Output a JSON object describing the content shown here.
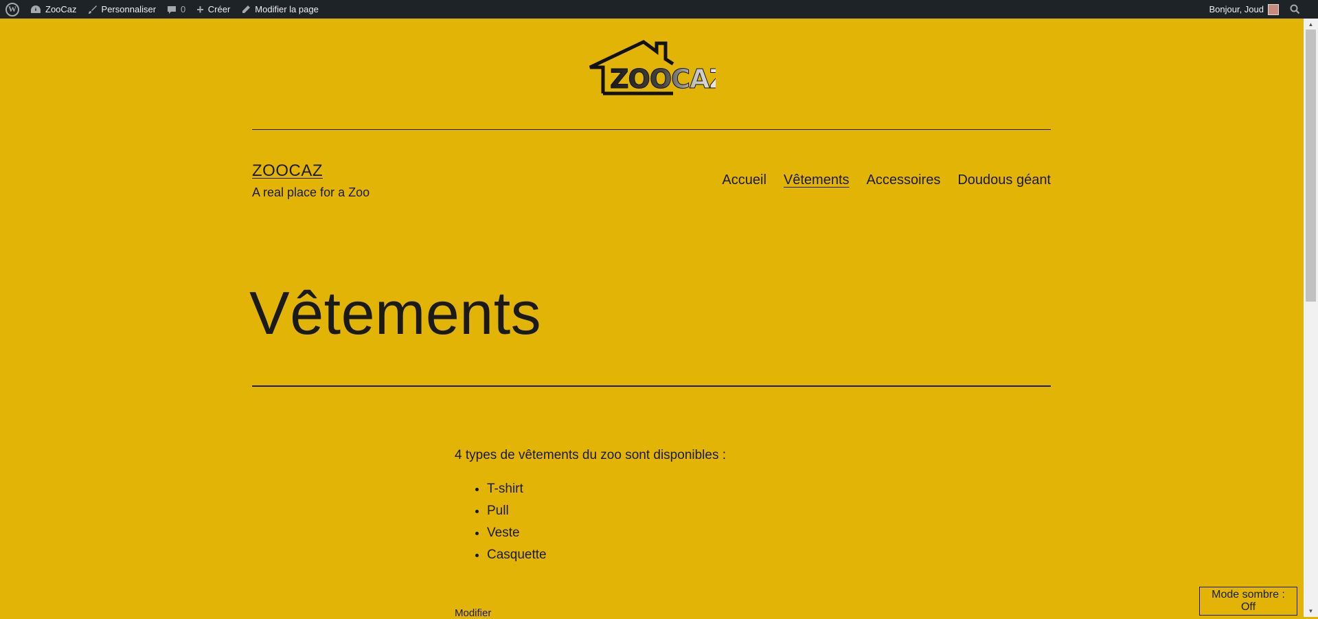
{
  "adminbar": {
    "site_name": "ZooCaz",
    "customize": "Personnaliser",
    "comments_count": "0",
    "new_label": "Créer",
    "edit_page": "Modifier la page",
    "greeting": "Bonjour, Joud"
  },
  "logo": {
    "text": "ZOOCAZ"
  },
  "site": {
    "title": "ZOOCAZ",
    "tagline": "A real place for a Zoo"
  },
  "nav": {
    "items": [
      {
        "label": "Accueil"
      },
      {
        "label": "Vêtements"
      },
      {
        "label": "Accessoires"
      },
      {
        "label": "Doudous géant"
      }
    ]
  },
  "page": {
    "title": "Vêtements",
    "intro": "4 types de vêtements du zoo sont disponibles :",
    "list": [
      "T-shirt",
      "Pull",
      "Veste",
      "Casquette"
    ],
    "edit_link": "Modifier"
  },
  "dark_mode": {
    "label": "Mode sombre : Off"
  },
  "colors": {
    "background": "#e2b405",
    "adminbar": "#1d2327",
    "text": "#1a1a1a"
  }
}
